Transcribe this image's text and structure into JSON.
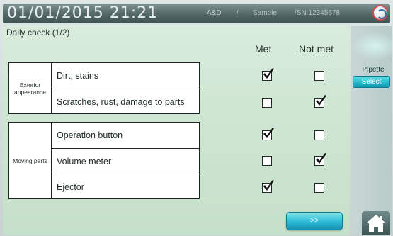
{
  "header": {
    "datetime": "01/01/2015 21:21",
    "brand": "A&D",
    "separator": "/",
    "user": "Sample",
    "serial": "/SN:12345678",
    "status_icon": "lifebuoy-icon"
  },
  "page": {
    "title": "Daily check (1/2)",
    "col_met": "Met",
    "col_not_met": "Not met"
  },
  "groups": [
    {
      "label": "Exterior appearance",
      "items": [
        {
          "label": "Dirt, stains",
          "met": true,
          "not_met": false
        },
        {
          "label": "Scratches, rust, damage to parts",
          "met": false,
          "not_met": true
        }
      ]
    },
    {
      "label": "Moving parts",
      "items": [
        {
          "label": "Operation button",
          "met": true,
          "not_met": false
        },
        {
          "label": "Volume meter",
          "met": false,
          "not_met": true
        },
        {
          "label": "Ejector",
          "met": true,
          "not_met": false
        }
      ]
    }
  ],
  "side": {
    "pipette_label": "Pipette",
    "select_label": "Select"
  },
  "footer": {
    "next_label": ">>",
    "home_icon": "home-icon"
  },
  "colors": {
    "header_bg": "#536866",
    "panel_bg": "#cfe6d3",
    "accent": "#22b6c9"
  }
}
